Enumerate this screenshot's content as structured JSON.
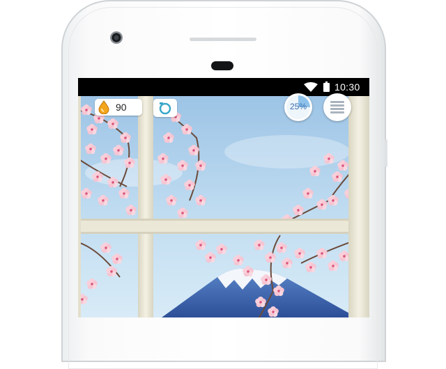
{
  "status_bar": {
    "time": "10:30",
    "icons": [
      "wifi-icon",
      "battery-icon"
    ]
  },
  "hud": {
    "water_drops": {
      "icon": "water-drop-icon",
      "value": "90"
    },
    "camera_button": {
      "icon": "camera-icon"
    },
    "progress": {
      "label": "25%",
      "fraction": 0.25
    },
    "menu_button": {
      "icon": "menu-icon"
    }
  },
  "scene": {
    "description_icons": [
      "cherry-blossom-branch",
      "mount-fuji",
      "window-frame"
    ]
  },
  "colors": {
    "status_bar_bg": "#000000",
    "sky": "#bfdcef",
    "window_frame": "#ece8d8",
    "blossom": "#f6c8d4",
    "progress_accent": "#3a6fb0",
    "drop": "#f3a51c"
  }
}
